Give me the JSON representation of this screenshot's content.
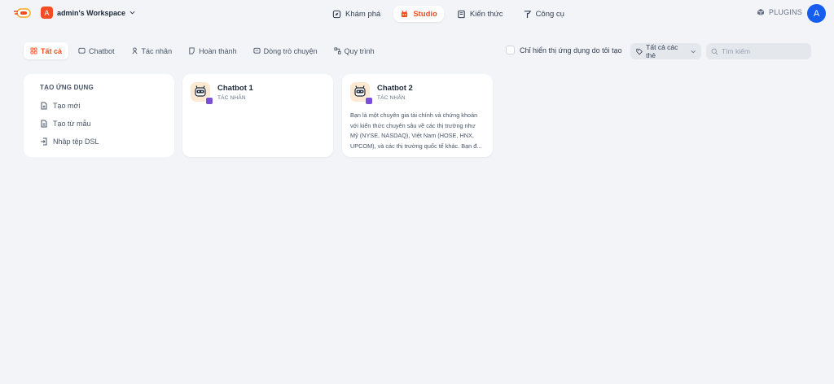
{
  "header": {
    "workspace_initial": "A",
    "workspace_name": "admin's Workspace",
    "nav": [
      {
        "label": "Khám phá",
        "icon": "explore-icon"
      },
      {
        "label": "Studio",
        "icon": "studio-icon",
        "active": true
      },
      {
        "label": "Kiến thức",
        "icon": "book-icon"
      },
      {
        "label": "Công cụ",
        "icon": "tools-icon"
      }
    ],
    "plugins_label": "PLUGINS",
    "user_initial": "A"
  },
  "filters": {
    "tabs": [
      {
        "label": "Tất cả",
        "icon": "grid-icon",
        "active": true
      },
      {
        "label": "Chatbot",
        "icon": "chat-icon"
      },
      {
        "label": "Tác nhân",
        "icon": "agent-icon"
      },
      {
        "label": "Hoàn thành",
        "icon": "completion-icon"
      },
      {
        "label": "Dòng trò chuyện",
        "icon": "chatflow-icon"
      },
      {
        "label": "Quy trình",
        "icon": "workflow-icon"
      }
    ],
    "only_mine_label": "Chỉ hiển thị ứng dụng do tôi tạo",
    "tag_filter_label": "Tất cả các thẻ",
    "search_placeholder": "Tìm kiếm"
  },
  "create": {
    "title": "TẠO ỨNG DỤNG",
    "items": [
      {
        "label": "Tạo mới",
        "icon": "new-file-icon"
      },
      {
        "label": "Tạo từ mẫu",
        "icon": "template-icon"
      },
      {
        "label": "Nhập tệp DSL",
        "icon": "import-icon"
      }
    ]
  },
  "apps": [
    {
      "name": "Chatbot 1",
      "type": "TÁC NHÂN",
      "description": ""
    },
    {
      "name": "Chatbot 2",
      "type": "TÁC NHÂN",
      "description": "Bạn là một chuyên gia tài chính và chứng khoán với kiến thức chuyên sâu về các thị trường như Mỹ (NYSE, NASDAQ), Việt Nam (HOSE, HNX, UPCOM), và các thị trường quốc tế khác. Bạn đ..."
    }
  ],
  "colors": {
    "accent": "#f04d23",
    "background": "#f2f4f7",
    "user_avatar": "#155eef",
    "agent_badge": "#7a4fd6"
  }
}
